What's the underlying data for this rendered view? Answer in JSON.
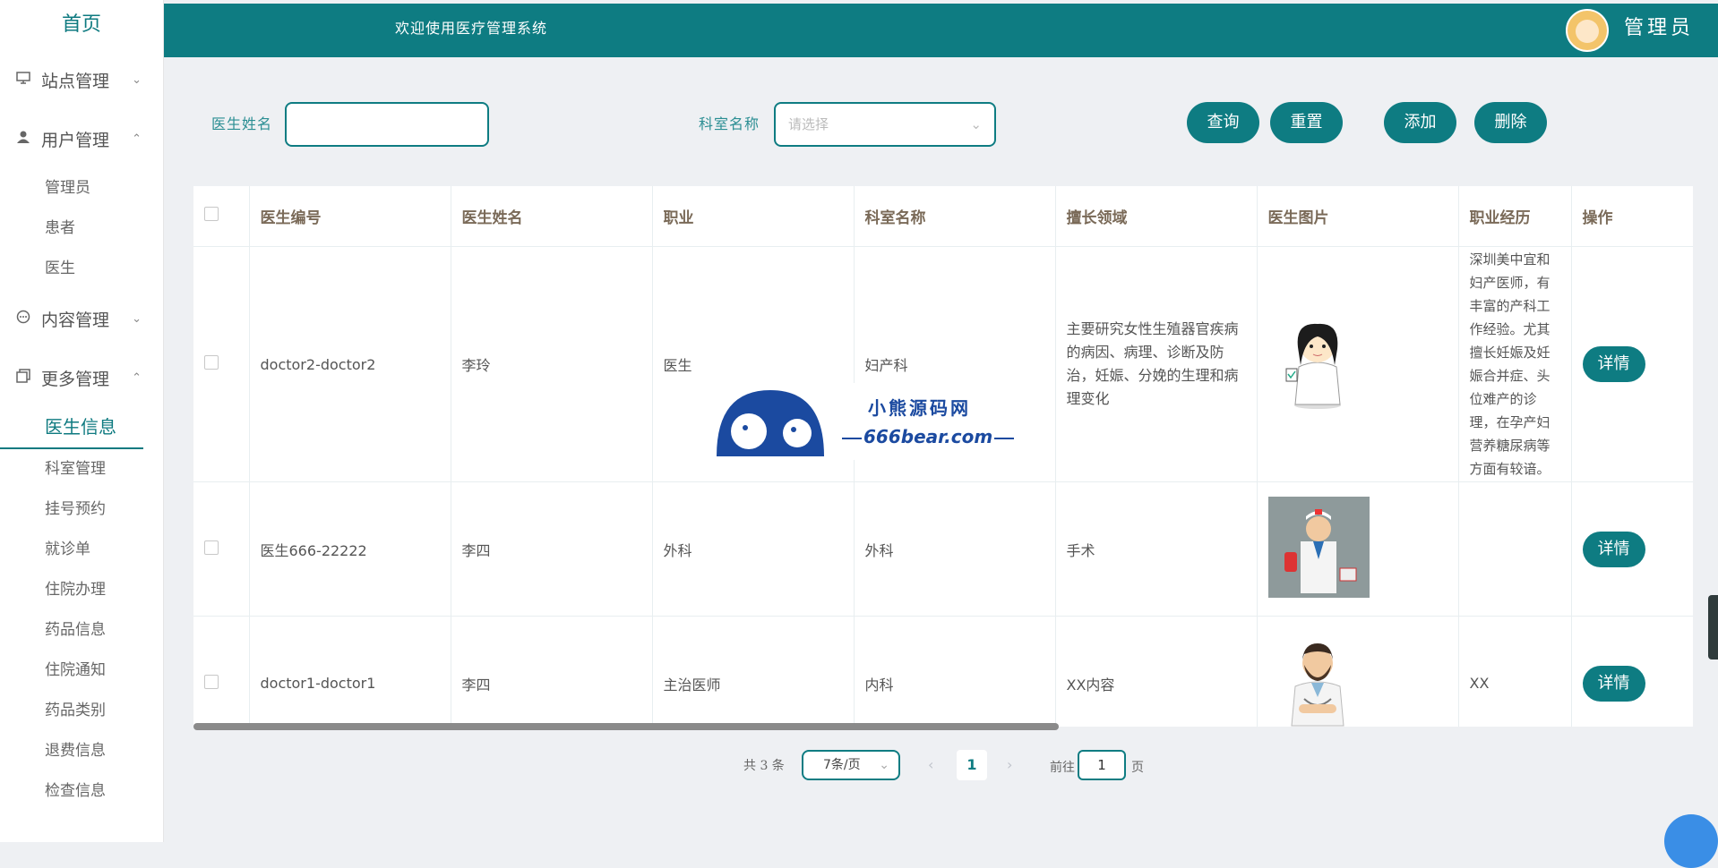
{
  "sidebar": {
    "home": "首页",
    "groups": [
      {
        "label": "站点管理",
        "icon": "monitor-icon",
        "expanded": false,
        "items": []
      },
      {
        "label": "用户管理",
        "icon": "user-icon",
        "expanded": true,
        "items": [
          "管理员",
          "患者",
          "医生"
        ]
      },
      {
        "label": "内容管理",
        "icon": "chat-icon",
        "expanded": false,
        "items": []
      },
      {
        "label": "更多管理",
        "icon": "copy-icon",
        "expanded": true,
        "items": [
          "医生信息",
          "科室管理",
          "挂号预约",
          "就诊单",
          "住院办理",
          "药品信息",
          "住院通知",
          "药品类别",
          "退费信息",
          "检查信息"
        ]
      }
    ]
  },
  "header": {
    "welcome": "欢迎使用医疗管理系统",
    "user": "管理员"
  },
  "filters": {
    "doctor_name_label": "医生姓名",
    "doctor_name_value": "",
    "dept_label": "科室名称",
    "dept_placeholder": "请选择"
  },
  "buttons": {
    "query": "查询",
    "reset": "重置",
    "add": "添加",
    "delete": "删除",
    "detail": "详情"
  },
  "table": {
    "columns": [
      "医生编号",
      "医生姓名",
      "职业",
      "科室名称",
      "擅长领域",
      "医生图片",
      "职业经历",
      "操作"
    ],
    "rows": [
      {
        "id": "doctor2-doctor2",
        "name": "李玲",
        "job": "医生",
        "dept": "妇产科",
        "specialty": "主要研究女性生殖器官疾病的病因、病理、诊断及防治，妊娠、分娩的生理和病理变化",
        "image": "female-doctor-cartoon",
        "experience": "深圳美中宜和妇产医师，有丰富的产科工作经验。尤其擅长妊娠及妊娠合并症、头位难产的诊理，在孕产妇营养糖尿病等方面有较谙。"
      },
      {
        "id": "医生666-22222",
        "name": "李四",
        "job": "外科",
        "dept": "外科",
        "specialty": "手术",
        "image": "male-doctor-cartoon",
        "experience": ""
      },
      {
        "id": "doctor1-doctor1",
        "name": "李四",
        "job": "主治医师",
        "dept": "内科",
        "specialty": "XX内容",
        "image": "bearded-doctor-cartoon",
        "experience": "XX"
      }
    ]
  },
  "pagination": {
    "total_text": "共 3 条",
    "page_size": "7条/页",
    "current_page": "1",
    "goto_label": "前往",
    "goto_value": "1",
    "page_suffix": "页"
  },
  "watermark": {
    "cn": "小熊源码网",
    "en": "666bear.com"
  },
  "colors": {
    "primary": "#0e7c82",
    "header_text": "#ffffff",
    "th_text": "#7a6a58"
  }
}
